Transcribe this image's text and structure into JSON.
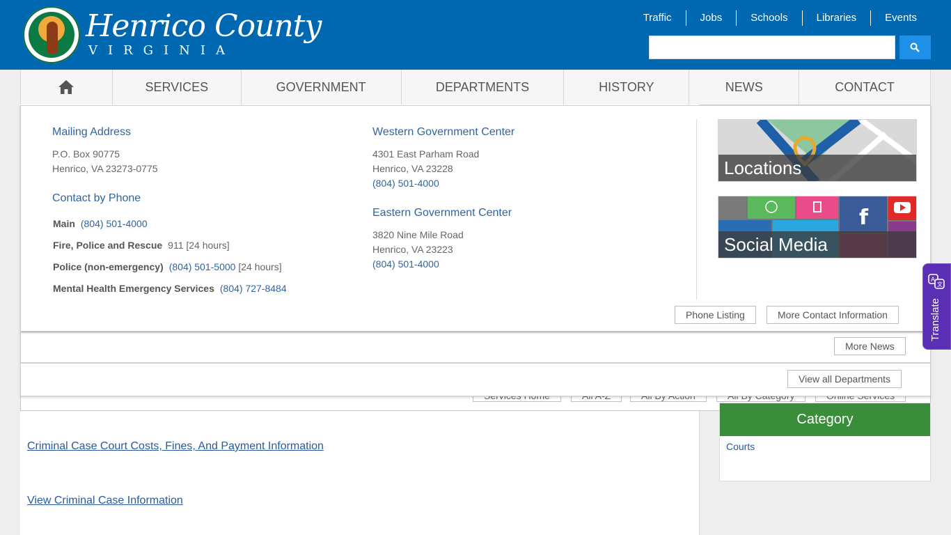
{
  "header": {
    "brand_name": "Henrico County",
    "brand_sub": "VIRGINIA",
    "top_links": [
      "Traffic",
      "Jobs",
      "Schools",
      "Libraries",
      "Events"
    ],
    "search": {
      "placeholder": ""
    }
  },
  "nav": {
    "items": [
      "SERVICES",
      "GOVERNMENT",
      "DEPARTMENTS",
      "HISTORY",
      "NEWS",
      "CONTACT"
    ]
  },
  "contact": {
    "mailing": {
      "title": "Mailing Address",
      "line1": "P.O. Box 90775",
      "line2": "Henrico, VA 23273-0775"
    },
    "phone_title": "Contact by Phone",
    "phones": [
      {
        "label": "Main",
        "number": "(804) 501-4000",
        "note": ""
      },
      {
        "label": "Fire, Police and Rescue",
        "number": "",
        "note": "911 [24 hours]"
      },
      {
        "label": "Police (non-emergency)",
        "number": "(804) 501-5000",
        "note": "[24 hours]"
      },
      {
        "label": "Mental Health Emergency Services",
        "number": "(804) 727-8484",
        "note": ""
      }
    ],
    "western": {
      "title": "Western Government Center",
      "line1": "4301 East Parham Road",
      "line2": "Henrico, VA 23228",
      "phone": "(804) 501-4000"
    },
    "eastern": {
      "title": "Eastern Government Center",
      "line1": "3820 Nine Mile Road",
      "line2": "Henrico, VA 23223",
      "phone": "(804) 501-4000"
    },
    "tiles": {
      "locations": "Locations",
      "social": "Social Media"
    },
    "buttons": {
      "phone_listing": "Phone Listing",
      "more_contact": "More Contact Information"
    }
  },
  "news_strip": {
    "more_news": "More News"
  },
  "departments_strip": {
    "view_all": "View all Departments"
  },
  "services_bar": [
    "Services Home",
    "All A-Z",
    "All By Action",
    "All By Category",
    "Online Services"
  ],
  "main_links": [
    "Criminal Case Court Costs, Fines, And Payment Information",
    "View Criminal Case Information"
  ],
  "side": {
    "heading": "Category",
    "link": "Courts"
  },
  "translate": {
    "label": "Translate"
  },
  "colors": {
    "header_blue": "#0067b1",
    "search_button": "#1e90e6",
    "category_green": "#3a8d3a",
    "translate_purple": "#5b2fb3",
    "link_blue": "#2f64a3"
  },
  "icons": [
    "home-icon",
    "search-icon",
    "translate-icon",
    "county-seal-logo"
  ]
}
